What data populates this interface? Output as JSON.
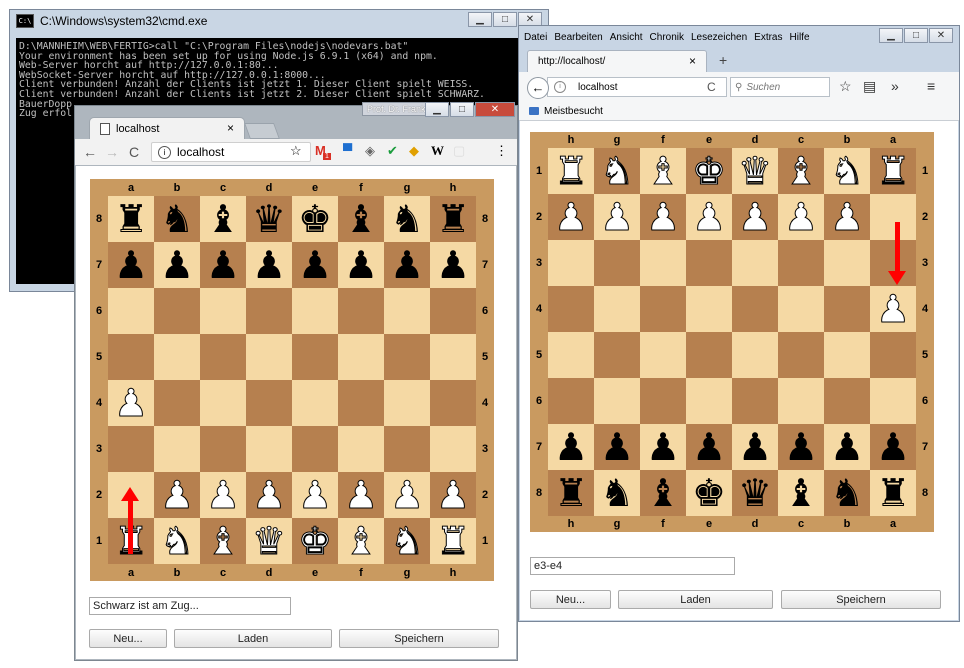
{
  "cmd": {
    "title": "C:\\Windows\\system32\\cmd.exe",
    "lines": [
      "D:\\MANNHEIM\\WEB\\FERTIG>call \"C:\\Program Files\\nodejs\\nodevars.bat\"",
      "Your environment has been set up for using Node.js 6.9.1 (x64) and npm.",
      "Web-Server horcht auf http://127.0.0.1:80...",
      "WebSocket-Server horcht auf http://127.0.0.1:8000...",
      "Client verbunden! Anzahl der Clients ist jetzt 1. Dieser Client spielt WEISS.",
      "Client verbunden! Anzahl der Clients ist jetzt 2. Dieser Client spielt SCHWARZ.",
      "BauerDopp",
      "Zug erfol"
    ]
  },
  "chrome": {
    "tab_title": "localhost",
    "url": "localhost",
    "profile_badge": "Prof. Dr. Frank",
    "ext_count": "1",
    "board": {
      "files": [
        "a",
        "b",
        "c",
        "d",
        "e",
        "f",
        "g",
        "h"
      ],
      "ranks": [
        "8",
        "7",
        "6",
        "5",
        "4",
        "3",
        "2",
        "1"
      ],
      "rows": [
        "rnbqkbnr",
        "pppppppp",
        "........",
        "........",
        "P.......",
        "........",
        ".PPPPPPP",
        "RNBQKBNR"
      ]
    },
    "status": "Schwarz ist am Zug...",
    "buttons": {
      "new": "Neu...",
      "load": "Laden",
      "save": "Speichern"
    }
  },
  "firefox": {
    "menu": [
      "Datei",
      "Bearbeiten",
      "Ansicht",
      "Chronik",
      "Lesezeichen",
      "Extras",
      "Hilfe"
    ],
    "tab_title": "http://localhost/",
    "url": "localhost",
    "search_placeholder": "Suchen",
    "bookmark": "Meistbesucht",
    "board": {
      "files": [
        "h",
        "g",
        "f",
        "e",
        "d",
        "c",
        "b",
        "a"
      ],
      "ranks": [
        "1",
        "2",
        "3",
        "4",
        "5",
        "6",
        "7",
        "8"
      ],
      "rows": [
        "RNBKQBNR",
        "PPPPPPP.",
        "........",
        ".......P",
        "........",
        "........",
        "pppppppp",
        "rnbkqbnr"
      ]
    },
    "move": "e3-e4",
    "buttons": {
      "new": "Neu...",
      "load": "Laden",
      "save": "Speichern"
    }
  }
}
